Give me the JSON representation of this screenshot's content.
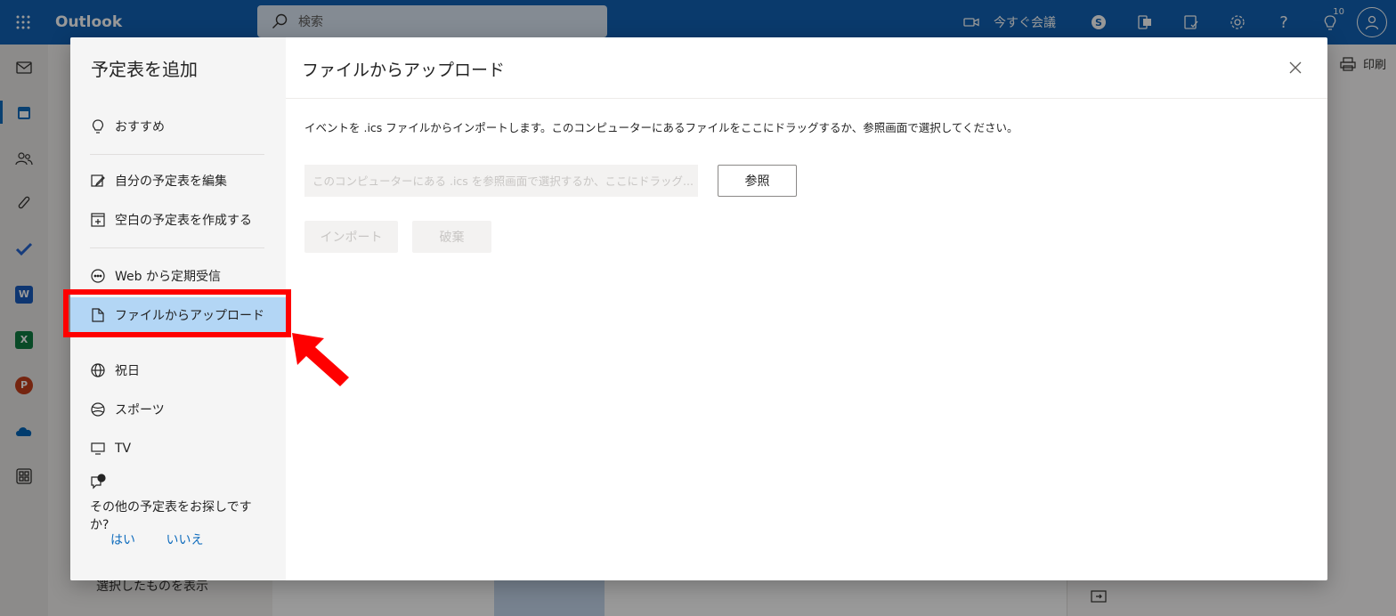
{
  "topbar": {
    "brand": "Outlook",
    "search_placeholder": "検索",
    "meet_now": "今すぐ会議",
    "tips_badge": "10"
  },
  "background": {
    "print_label": "印刷",
    "show_selected": "選択したものを表示"
  },
  "dialog": {
    "title": "予定表を追加",
    "nav": {
      "suggested": "おすすめ",
      "edit_calendars": "自分の予定表を編集",
      "create_blank": "空白の予定表を作成する",
      "subscribe_web": "Web から定期受信",
      "upload_file": "ファイルからアップロード",
      "holidays": "祝日",
      "sports": "スポーツ",
      "tv": "TV"
    },
    "more_prompt": "その他の予定表をお探しですか?",
    "yes": "はい",
    "no": "いいえ",
    "content": {
      "title": "ファイルからアップロード",
      "description": "イベントを .ics ファイルからインポートします。このコンピューターにあるファイルをここにドラッグするか、参照画面で選択してください。",
      "file_placeholder": "このコンピューターにある .ics を参照画面で選択するか、ここにドラッグ...",
      "browse": "参照",
      "import": "インポート",
      "discard": "破棄"
    }
  },
  "colors": {
    "topbar": "#1162b4",
    "selected_nav": "#b3d6f5",
    "annotation": "#ff0000",
    "link": "#0f6cbd"
  }
}
